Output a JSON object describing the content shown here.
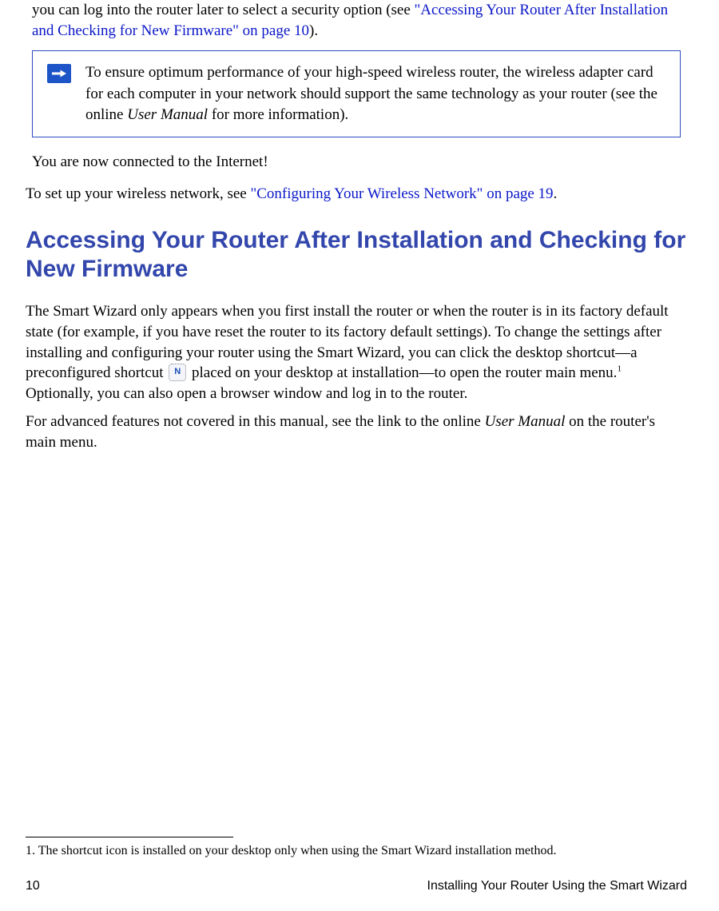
{
  "intro": {
    "line1_prefix": "you can log into the router later to select a security option (see ",
    "link1": "\"Accessing Your Router After Installation and Checking for New Firmware\" on page 10",
    "line1_suffix": ")."
  },
  "note": {
    "text_pre": "To ensure optimum performance of your high-speed wireless router, the wireless adapter card for each computer in your network should support the same technology as your router (see the online ",
    "italic": "User Manual",
    "text_post": " for more information)."
  },
  "connected": "You are now connected to the Internet!",
  "setup": {
    "prefix": "To set up your wireless network, see  ",
    "link": "\"Configuring Your Wireless Network\" on page 19",
    "suffix": "."
  },
  "heading": "Accessing Your Router After Installation and Checking for New Firmware",
  "para1_a": "The Smart Wizard only appears when you first install the router or when the router is in its factory default state (for example, if you have reset the router to its factory default settings). To change the settings after installing and configuring your router using the Smart Wizard, you can click the desktop shortcut—a preconfigured shortcut ",
  "para1_b": " placed on your desktop at installation—to open the router main menu.",
  "para1_footref": "1",
  "para1_c": " Optionally, you can also open a browser window and log in to the router.",
  "para2_a": "For advanced features not covered in this manual, see the link to the online ",
  "para2_italic": "User Manual",
  "para2_b": " on the router's main menu.",
  "footnote": "1. The shortcut icon is installed on your desktop only when using the Smart Wizard installation method.",
  "footer": {
    "page": "10",
    "chapter": "Installing Your Router Using the Smart Wizard"
  },
  "icons": {
    "shortcut_letter": "N"
  }
}
